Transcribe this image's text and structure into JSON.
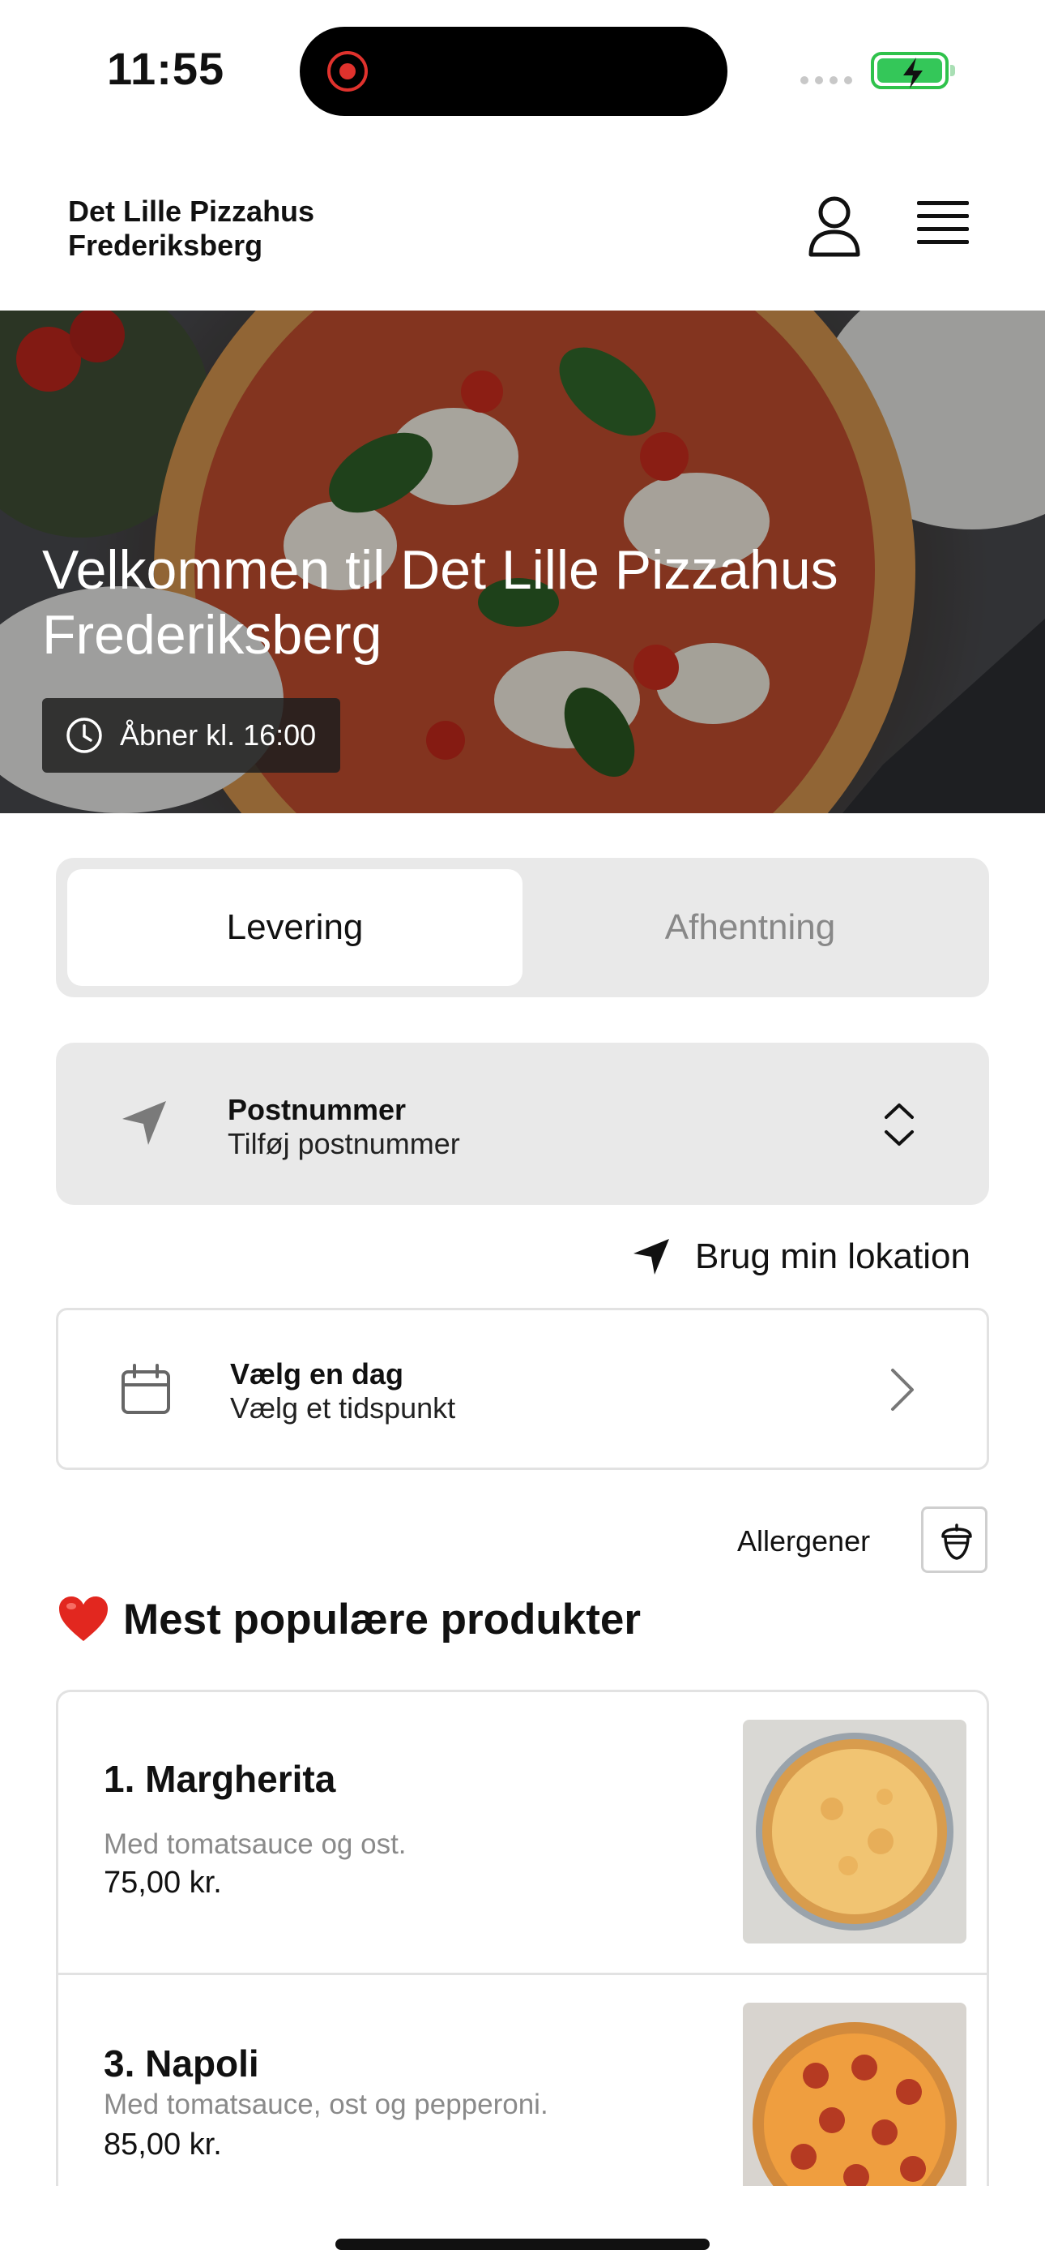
{
  "status_bar": {
    "time": "11:55",
    "battery_color": "#34c759",
    "recording_color": "#e0322d"
  },
  "header": {
    "brand_line1": "Det Lille Pizzahus",
    "brand_line2": "Frederiksberg",
    "profile_icon": "person-icon",
    "menu_icon": "hamburger-icon"
  },
  "hero": {
    "title": "Velkommen til Det Lille Pizzahus Frederiksberg",
    "hours": "Åbner kl. 16:00"
  },
  "order_type": {
    "tabs": [
      {
        "label": "Levering",
        "selected": true
      },
      {
        "label": "Afhentning",
        "selected": false
      }
    ]
  },
  "postal": {
    "label": "Postnummer",
    "placeholder": "Tilføj postnummer"
  },
  "location": {
    "label": "Brug min lokation"
  },
  "schedule": {
    "label": "Vælg en dag",
    "sub": "Vælg et tidspunkt"
  },
  "allergens": {
    "label": "Allergener"
  },
  "popular": {
    "title": "Mest populære produkter",
    "products": [
      {
        "name": "1. Margherita",
        "description": "Med tomatsauce og ost.",
        "price": "75,00 kr."
      },
      {
        "name": "3. Napoli",
        "description": "Med tomatsauce, ost og pepperoni.",
        "price": "85,00 kr."
      }
    ]
  }
}
